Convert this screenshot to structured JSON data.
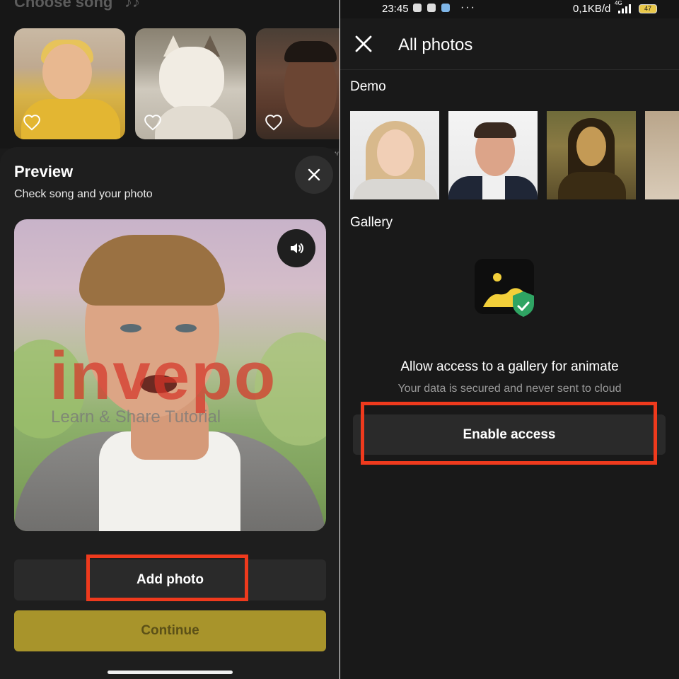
{
  "left": {
    "choose_song_title": "Choose song",
    "watermark": {
      "brand": "invepo",
      "tagline": "Learn & Share Tutorial"
    },
    "preview": {
      "title": "Preview",
      "subtitle": "Check song and your photo",
      "add_photo_label": "Add photo",
      "continue_label": "Continue"
    },
    "peek_label": "w"
  },
  "right": {
    "status_bar": {
      "time": "23:45",
      "more": "···",
      "speed": "0,1KB/d",
      "network": "4G",
      "battery": "47"
    },
    "title": "All photos",
    "demo_label": "Demo",
    "gallery_label": "Gallery",
    "access_title": "Allow access to a gallery for animate",
    "access_subtitle": "Your data is secured and never sent to cloud",
    "enable_label": "Enable access"
  },
  "colors": {
    "highlight": "#ef3a1d",
    "continue_bg": "#a8942b",
    "gallery_icon_yellow": "#f2cf3a",
    "shield_green": "#2fa463"
  }
}
